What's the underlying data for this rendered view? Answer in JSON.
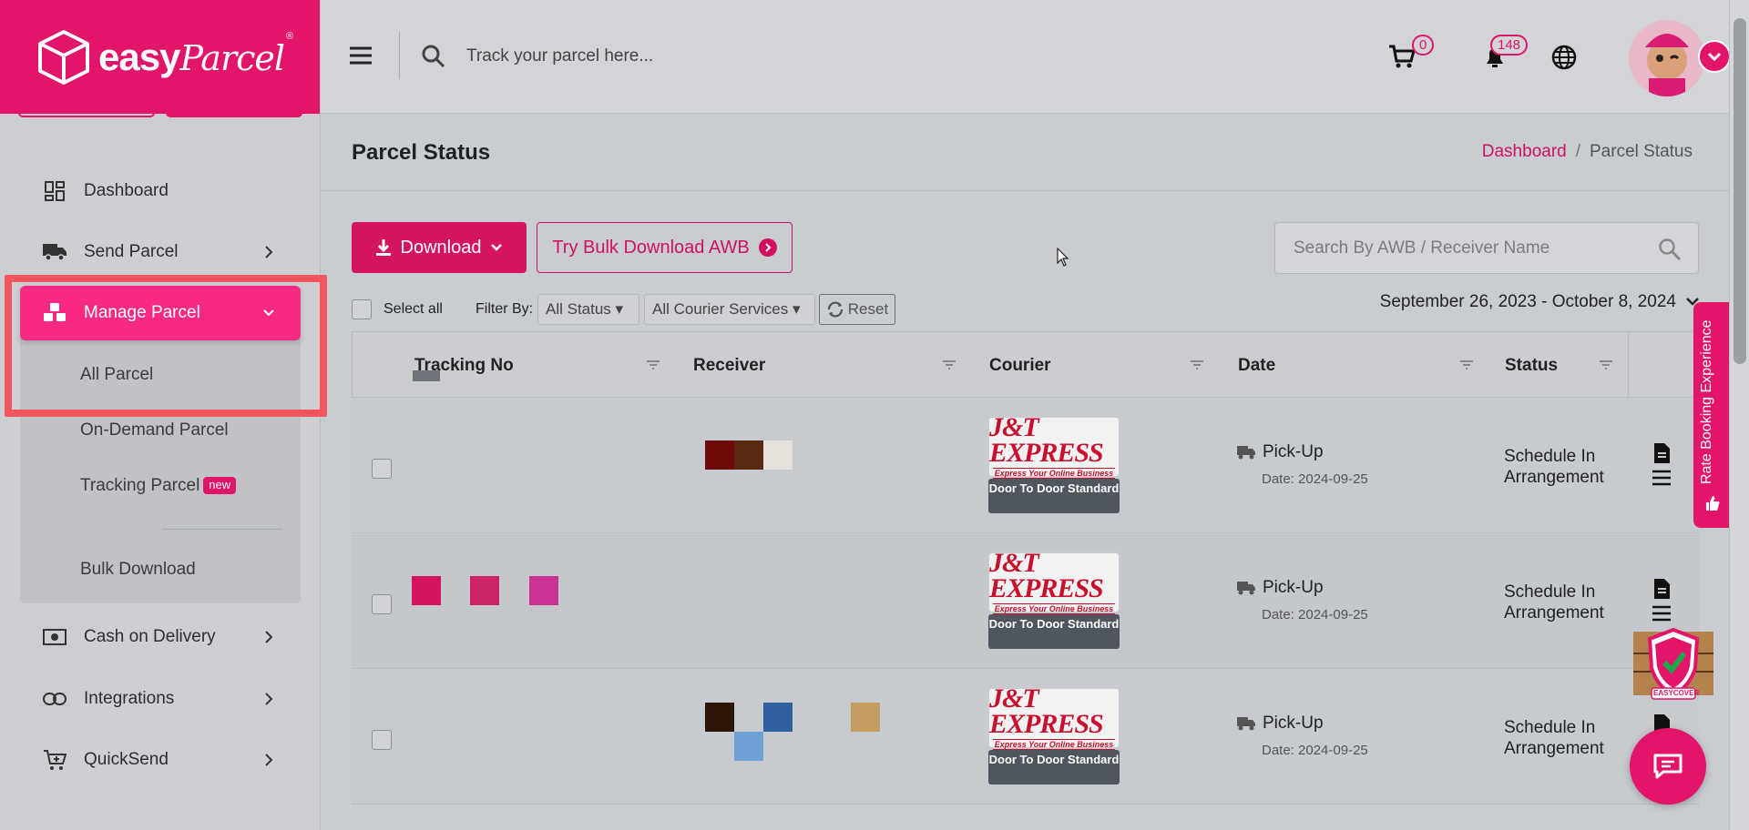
{
  "brand": {
    "logo_text_easy": "easy",
    "logo_text_parcel": "Parcel",
    "logo_reg": "®",
    "primary_color": "#e2156b"
  },
  "sidebar": {
    "items": [
      {
        "label": "Dashboard",
        "icon": "dashboard-icon"
      },
      {
        "label": "Send Parcel",
        "icon": "truck-icon"
      },
      {
        "label": "Manage Parcel",
        "icon": "boxes-icon"
      },
      {
        "label": "Cash on Delivery",
        "icon": "cash-icon"
      },
      {
        "label": "Integrations",
        "icon": "link-icon"
      },
      {
        "label": "QuickSend",
        "icon": "cart-plus-icon"
      }
    ],
    "submenu": [
      {
        "label": "All Parcel"
      },
      {
        "label": "On-Demand Parcel"
      },
      {
        "label": "Tracking Parcel",
        "badge": "new"
      },
      {
        "label": "Bulk Download"
      }
    ]
  },
  "topbar": {
    "track_placeholder": "Track your parcel here...",
    "cart_count": "0",
    "notif_count": "148"
  },
  "page": {
    "title": "Parcel Status",
    "breadcrumb": {
      "home": "Dashboard",
      "sep": "/",
      "current": "Parcel Status"
    }
  },
  "toolbar": {
    "download_label": "Download",
    "bulk_label": "Try Bulk Download AWB",
    "search_placeholder": "Search By AWB / Receiver Name",
    "select_all": "Select all",
    "filter_by": "Filter By:",
    "status_filter": "All Status",
    "courier_filter": "All Courier Services",
    "reset_label": "Reset",
    "date_range": "September 26, 2023 - October 8, 2024"
  },
  "table": {
    "headers": [
      "Tracking No",
      "Receiver",
      "Courier",
      "Date",
      "Status"
    ],
    "rows": [
      {
        "courier": "J&T EXPRESS",
        "courier_tag": "Express Your Online Business",
        "service": "Door To Door Standard",
        "event": "Pick-Up",
        "date": "Date: 2024-09-25",
        "status": "Schedule In Arrangement"
      },
      {
        "courier": "J&T EXPRESS",
        "courier_tag": "Express Your Online Business",
        "service": "Door To Door Standard",
        "event": "Pick-Up",
        "date": "Date: 2024-09-25",
        "status": "Schedule In Arrangement"
      },
      {
        "courier": "J&T EXPRESS",
        "courier_tag": "Express Your Online Business",
        "service": "Door To Door Standard",
        "event": "Pick-Up",
        "date": "Date: 2024-09-25",
        "status": "Schedule In Arrangement"
      }
    ]
  },
  "widgets": {
    "rate_booking": "Rate Booking Experience",
    "easycover": "EASYCOVER"
  }
}
